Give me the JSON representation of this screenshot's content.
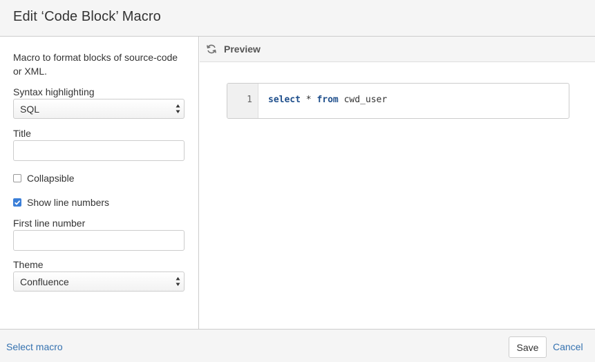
{
  "dialog": {
    "title": "Edit ‘Code Block’ Macro"
  },
  "form": {
    "description": "Macro to format blocks of source-code or XML.",
    "syntax_label": "Syntax highlighting",
    "syntax_value": "SQL",
    "title_label": "Title",
    "title_value": "",
    "collapsible_label": "Collapsible",
    "collapsible_checked": false,
    "line_numbers_label": "Show line numbers",
    "line_numbers_checked": true,
    "first_line_label": "First line number",
    "first_line_value": "",
    "theme_label": "Theme",
    "theme_value": "Confluence"
  },
  "preview": {
    "label": "Preview",
    "line_number": "1",
    "code": {
      "kw1": "select",
      "op": " * ",
      "kw2": "from",
      "rest": " cwd_user"
    }
  },
  "footer": {
    "select_macro_label": "Select macro",
    "save_label": "Save",
    "cancel_label": "Cancel"
  },
  "colors": {
    "accent": "#3b7fd8",
    "link": "#3572b0",
    "keyword": "#1f4f8c"
  },
  "icons": {
    "refresh": "refresh-icon",
    "select_arrows": "select-arrows-icon",
    "check": "check-icon"
  }
}
